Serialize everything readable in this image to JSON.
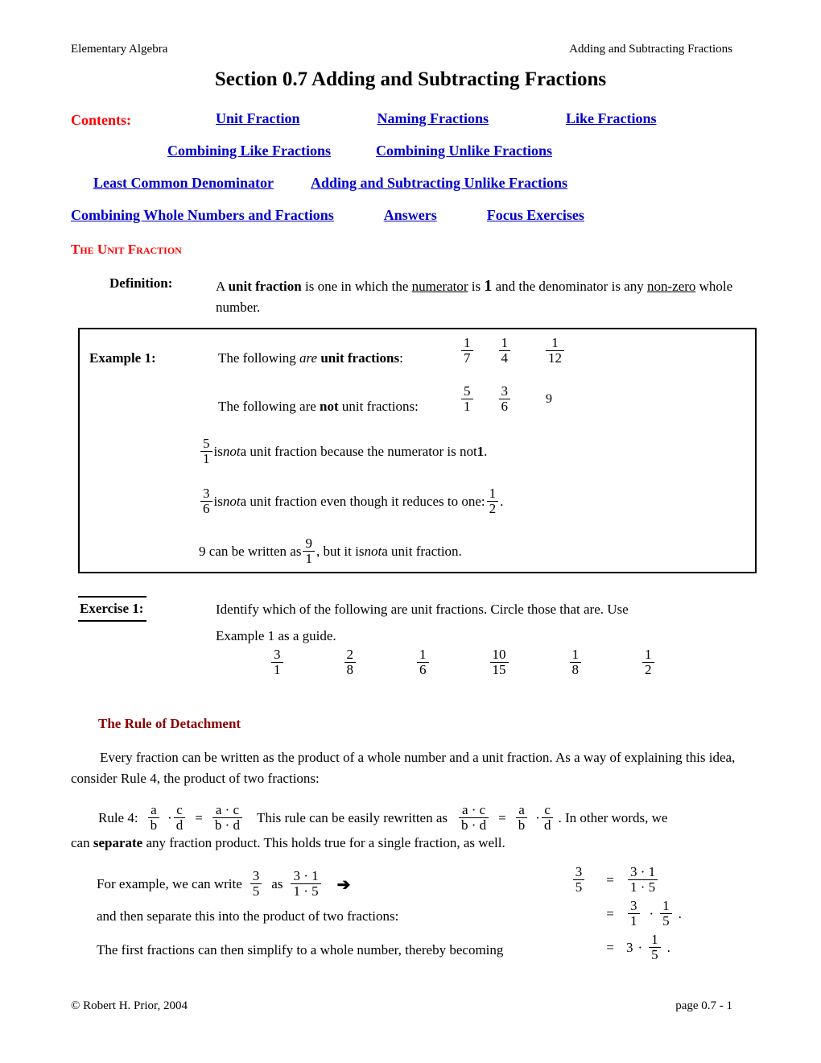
{
  "running_head": {
    "left": "Elementary Algebra",
    "right": "Adding and Subtracting Fractions"
  },
  "title": "Section 0.7  Adding and Subtracting Fractions",
  "contents": {
    "label": "Contents:",
    "row1": [
      "Unit Fraction",
      "Naming Fractions",
      "Like Fractions"
    ],
    "row2": [
      "Combining Like Fractions",
      "Combining Unlike Fractions"
    ],
    "row3": [
      "Least Common Denominator",
      "Adding and Subtracting Unlike Fractions"
    ],
    "row4": [
      "Combining Whole Numbers and  Fractions",
      "Answers",
      "Focus Exercises"
    ]
  },
  "section_heading": "The Unit Fraction",
  "definition": {
    "label": "Definition:",
    "t1": "A ",
    "t2": "unit fraction",
    "t3": " is one in which the ",
    "t4": "numerator",
    "t5": " is ",
    "t6": "1",
    "t7": " and the denominator is any ",
    "t8": "non-zero",
    "t9": " whole number."
  },
  "example1": {
    "label": "Example 1:",
    "line1_a": "The following ",
    "line1_b": "are",
    "line1_c": " ",
    "line1_d": "unit fractions",
    "line1_e": ":",
    "line2_a": "The following are ",
    "line2_b": "not",
    "line2_c": " unit fractions:",
    "are_fractions": [
      {
        "num": "1",
        "den": "7"
      },
      {
        "num": "1",
        "den": "4"
      },
      {
        "num": "1",
        "den": "12"
      }
    ],
    "not_fractions": [
      {
        "num": "5",
        "den": "1"
      },
      {
        "num": "3",
        "den": "6"
      },
      {
        "whole": "9"
      }
    ],
    "p1": {
      "frac": {
        "num": "5",
        "den": "1"
      },
      "a": " is ",
      "b": "not",
      "c": " a unit fraction because the numerator is not ",
      "d": "1",
      "e": "."
    },
    "p2": {
      "frac": {
        "num": "3",
        "den": "6"
      },
      "a": " is ",
      "b": "not",
      "c": " a unit fraction even though it reduces to one: ",
      "frac2": {
        "num": "1",
        "den": "2"
      },
      "d": " ."
    },
    "p3": {
      "a": "9 can be written as ",
      "frac": {
        "num": "9",
        "den": "1"
      },
      "b": " , but it is ",
      "c": "not",
      "d": " a unit fraction."
    }
  },
  "exercise1": {
    "label": "Exercise 1:",
    "text_line1": "Identify which of the following are unit fractions.  Circle those that are.  Use",
    "text_line2": "Example 1 as a guide.",
    "fractions": [
      {
        "num": "3",
        "den": "1"
      },
      {
        "num": "2",
        "den": "8"
      },
      {
        "num": "1",
        "den": "6"
      },
      {
        "num": "10",
        "den": "15"
      },
      {
        "num": "1",
        "den": "8"
      },
      {
        "num": "1",
        "den": "2"
      }
    ]
  },
  "detachment": {
    "heading": "The Rule of Detachment",
    "paragraph": "Every fraction can be written as the product of a whole number and a unit fraction. As a way of explaining this idea, consider Rule 4, the product of two fractions:",
    "rule4_label": "Rule 4:",
    "f_a_b": {
      "num": "a",
      "den": "b"
    },
    "dot1": "·",
    "f_c_d": {
      "num": "c",
      "den": "d"
    },
    "eq1": "=",
    "f_ac_bd": {
      "num": "a · c",
      "den": "b · d"
    },
    "mid_text": "This rule can be easily rewritten as",
    "f_ac_bd_2": {
      "num": "a · c",
      "den": "b · d"
    },
    "eq2": "=",
    "f_a_b_2": {
      "num": "a",
      "den": "b"
    },
    "dot2": "·",
    "f_c_d_2": {
      "num": "c",
      "den": "d"
    },
    "tail_text": ". In other words, we",
    "line2_a": "can ",
    "line2_b": "separate",
    "line2_c": " any fraction product. This holds true for a single fraction, as well.",
    "forex_a": "For example,  we can write",
    "forex_frac1": {
      "num": "3",
      "den": "5"
    },
    "forex_as": "as",
    "forex_frac2": {
      "num": "3 · 1",
      "den": "1 · 5"
    },
    "arrow": "➔",
    "sep_text": "and then separate this into the product of two fractions:",
    "simp_text": "The first fractions can then simplify to a whole number, thereby becoming"
  },
  "equations": {
    "row1": {
      "lhs": {
        "num": "3",
        "den": "5"
      },
      "eq": "=",
      "rhs": {
        "num": "3 · 1",
        "den": "1 · 5"
      }
    },
    "row2": {
      "eq": "=",
      "rhs_a": {
        "num": "3",
        "den": "1"
      },
      "dot": "·",
      "rhs_b": {
        "num": "1",
        "den": "5"
      },
      "period": "."
    },
    "row3": {
      "eq": "=",
      "whole": "3",
      "dot": "·",
      "rhs": {
        "num": "1",
        "den": "5"
      },
      "period": "."
    }
  },
  "footer": {
    "left": "© Robert H. Prior, 2004",
    "right": "page 0.7 - 1"
  },
  "colors": {
    "link": "#0000CC",
    "red": "#FF0000",
    "maroon": "#8B0000"
  }
}
